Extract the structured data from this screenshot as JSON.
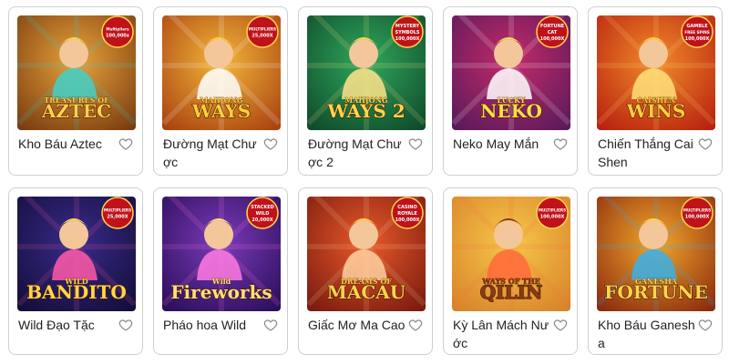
{
  "games": [
    {
      "title": "Kho Báu Aztec",
      "logo_lines": [
        "TREASURES OF",
        "AZTEC"
      ],
      "badge_lines": [
        "Multipliers",
        "100,000x"
      ],
      "colors": {
        "bg1": "#e8a23a",
        "bg2": "#7a3c10",
        "accent": "#3fd1c8",
        "logo": "#ffd34a"
      },
      "heart_icon": "heart-outline-icon"
    },
    {
      "title": "Đường Mạt Chược",
      "logo_lines": [
        "MAHJONG",
        "WAYS"
      ],
      "badge_lines": [
        "MULTIPLIERS",
        "25,000X"
      ],
      "colors": {
        "bg1": "#f3b53a",
        "bg2": "#a8420f",
        "accent": "#ffffff",
        "logo": "#ffcf3a"
      },
      "heart_icon": "heart-outline-icon"
    },
    {
      "title": "Đường Mạt Chược 2",
      "logo_lines": [
        "MAHJONG",
        "WAYS 2"
      ],
      "badge_lines": [
        "MYSTERY",
        "SYMBOLS",
        "100,000X"
      ],
      "colors": {
        "bg1": "#2fa85c",
        "bg2": "#0f4a2a",
        "accent": "#ffe38a",
        "logo": "#ffd64a"
      },
      "heart_icon": "heart-outline-icon"
    },
    {
      "title": "Neko May Mắn",
      "logo_lines": [
        "LUCKY",
        "NEKO"
      ],
      "badge_lines": [
        "FORTUNE",
        "CAT",
        "100,000X"
      ],
      "colors": {
        "bg1": "#c42a6a",
        "bg2": "#5a1a5a",
        "accent": "#ffffff",
        "logo": "#f9e04a"
      },
      "heart_icon": "heart-outline-icon"
    },
    {
      "title": "Chiến Thắng Cai Shen",
      "logo_lines": [
        "CAISHEN",
        "WINS"
      ],
      "badge_lines": [
        "GAMBLE",
        "FREE SPINS",
        "100,000X"
      ],
      "colors": {
        "bg1": "#f08a2a",
        "bg2": "#b8200f",
        "accent": "#ffe07a",
        "logo": "#ffcf3a"
      },
      "heart_icon": "heart-outline-icon"
    },
    {
      "title": "Wild Đạo Tặc",
      "logo_lines": [
        "WILD",
        "BANDITO"
      ],
      "badge_lines": [
        "MULTIPLIERS",
        "25,000X"
      ],
      "colors": {
        "bg1": "#3a2a8a",
        "bg2": "#120e3a",
        "accent": "#ff5aa8",
        "logo": "#ffd64a"
      },
      "heart_icon": "heart-outline-icon"
    },
    {
      "title": "Pháo hoa Wild",
      "logo_lines": [
        "Wild",
        "Fireworks"
      ],
      "badge_lines": [
        "STACKED",
        "WILD",
        "20,000X"
      ],
      "colors": {
        "bg1": "#7a3ab8",
        "bg2": "#2a0e5a",
        "accent": "#ff7ae0",
        "logo": "#ffe17a"
      },
      "heart_icon": "heart-outline-icon"
    },
    {
      "title": "Giấc Mơ Ma Cao",
      "logo_lines": [
        "DREAMS OF",
        "MACAU"
      ],
      "badge_lines": [
        "CASINO",
        "ROYALE",
        "100,000X"
      ],
      "colors": {
        "bg1": "#e85a2a",
        "bg2": "#7a1a0f",
        "accent": "#ffd0a0",
        "logo": "#ffd34a"
      },
      "heart_icon": "heart-outline-icon"
    },
    {
      "title": "Kỳ Lân Mách Nước",
      "logo_lines": [
        "WAYS OF THE",
        "QILIN"
      ],
      "badge_lines": [
        "MULTIPLIERS",
        "100,000X"
      ],
      "colors": {
        "bg1": "#f6c84a",
        "bg2": "#d8822a",
        "accent": "#ff6a3a",
        "logo": "#8a3a12"
      },
      "heart_icon": "heart-outline-icon"
    },
    {
      "title": "Kho Báu Ganesha",
      "logo_lines": [
        "GANESHA",
        "FORTUNE"
      ],
      "badge_lines": [
        "MULTIPLIERS",
        "100,000X"
      ],
      "colors": {
        "bg1": "#f2a62a",
        "bg2": "#8a2a0f",
        "accent": "#3ab0e8",
        "logo": "#ffd64a"
      },
      "heart_icon": "heart-outline-icon"
    }
  ]
}
